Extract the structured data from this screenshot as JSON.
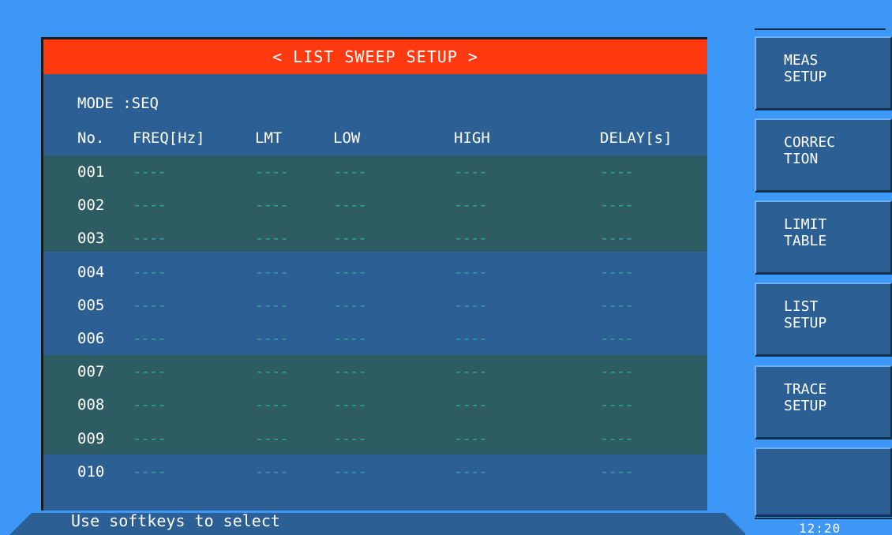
{
  "title": "< LIST SWEEP SETUP >",
  "mode": {
    "label": "MODE",
    "value": ":SEQ"
  },
  "columns": [
    "No.",
    "FREQ[Hz]",
    "LMT",
    "LOW",
    "HIGH",
    "DELAY[s]"
  ],
  "rows": [
    {
      "no": "001",
      "freq": "----",
      "lmt": "----",
      "low": "----",
      "high": "----",
      "delay": "----"
    },
    {
      "no": "002",
      "freq": "----",
      "lmt": "----",
      "low": "----",
      "high": "----",
      "delay": "----"
    },
    {
      "no": "003",
      "freq": "----",
      "lmt": "----",
      "low": "----",
      "high": "----",
      "delay": "----"
    },
    {
      "no": "004",
      "freq": "----",
      "lmt": "----",
      "low": "----",
      "high": "----",
      "delay": "----"
    },
    {
      "no": "005",
      "freq": "----",
      "lmt": "----",
      "low": "----",
      "high": "----",
      "delay": "----"
    },
    {
      "no": "006",
      "freq": "----",
      "lmt": "----",
      "low": "----",
      "high": "----",
      "delay": "----"
    },
    {
      "no": "007",
      "freq": "----",
      "lmt": "----",
      "low": "----",
      "high": "----",
      "delay": "----"
    },
    {
      "no": "008",
      "freq": "----",
      "lmt": "----",
      "low": "----",
      "high": "----",
      "delay": "----"
    },
    {
      "no": "009",
      "freq": "----",
      "lmt": "----",
      "low": "----",
      "high": "----",
      "delay": "----"
    },
    {
      "no": "010",
      "freq": "----",
      "lmt": "----",
      "low": "----",
      "high": "----",
      "delay": "----"
    }
  ],
  "status": "Use softkeys to select",
  "softkeys": [
    {
      "line1": "MEAS",
      "line2": "SETUP"
    },
    {
      "line1": "CORREC",
      "line2": "TION"
    },
    {
      "line1": "LIMIT",
      "line2": "TABLE"
    },
    {
      "line1": "LIST",
      "line2": "SETUP"
    },
    {
      "line1": "TRACE",
      "line2": "SETUP"
    },
    {
      "line1": "",
      "line2": ""
    }
  ],
  "clock": "12:20",
  "colors": {
    "background": "#3d97f7",
    "panel": "#2c5f94",
    "title_bar": "#ff3a10",
    "row_band_green": "#2e5c63",
    "dash": "#2fa59a"
  }
}
